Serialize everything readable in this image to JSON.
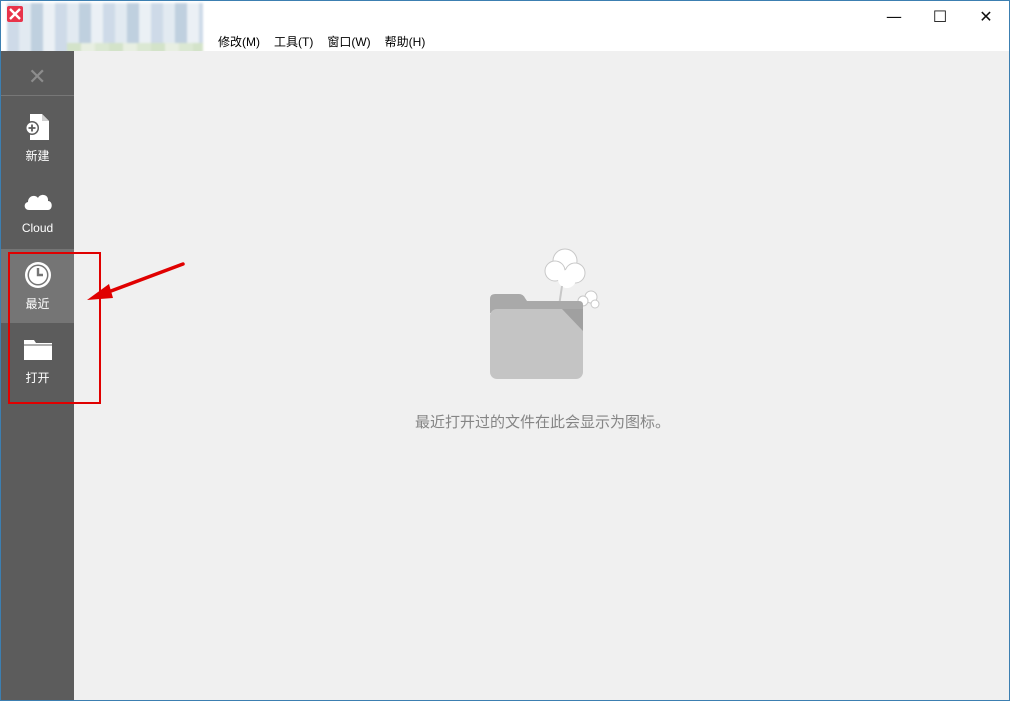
{
  "window": {
    "menu": [
      "修改(M)",
      "工具(T)",
      "窗口(W)",
      "帮助(H)"
    ],
    "controls": {
      "minimize": "—",
      "maximize": "☐",
      "close": "✕"
    }
  },
  "sidebar": {
    "close_glyph": "✕",
    "items": [
      {
        "label": "新建",
        "icon": "new-file-icon",
        "active": false
      },
      {
        "label": "Cloud",
        "icon": "cloud-icon",
        "active": false
      },
      {
        "label": "最近",
        "icon": "clock-icon",
        "active": true
      },
      {
        "label": "打开",
        "icon": "folder-icon",
        "active": false
      }
    ]
  },
  "main": {
    "empty_message": "最近打开过的文件在此会显示为图标。",
    "illustration": "empty-folder-smoke-icon"
  },
  "colors": {
    "sidebar_bg": "#5c5c5c",
    "sidebar_active": "#757575",
    "main_bg": "#f0f0f0",
    "annotation_red": "#e00000"
  }
}
